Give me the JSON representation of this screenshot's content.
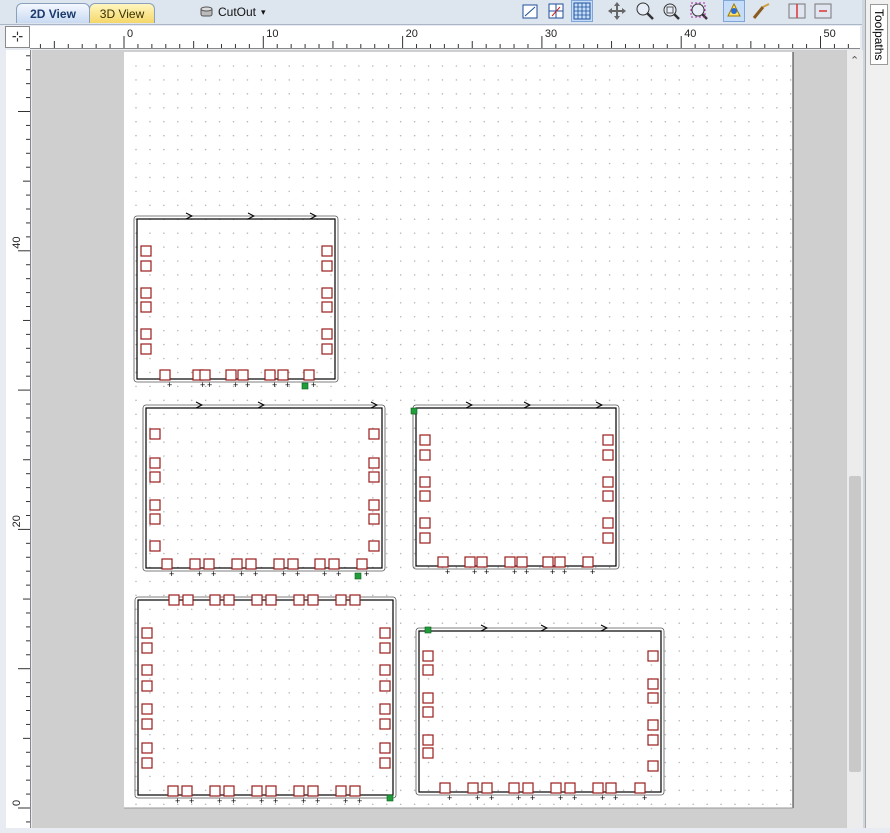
{
  "tabs": [
    {
      "label": "2D View",
      "active": true
    },
    {
      "label": "3D View",
      "active": false
    }
  ],
  "layer_dropdown": {
    "label": "CutOut",
    "arrow": "▾",
    "icon": "layer-stack-icon"
  },
  "toolbar_icons": [
    "set-job-size-icon",
    "edit-grid-icon",
    "snap-grid-icon",
    "pan-icon",
    "zoom-box-icon",
    "zoom-extents-icon",
    "zoom-selection-icon",
    "vector-select-icon",
    "node-edit-icon",
    "align-left-icon",
    "align-center-icon"
  ],
  "side_panel": {
    "label": "Toolpaths"
  },
  "ruler": {
    "horizontal_ticks": [
      "0",
      "10",
      "20",
      "30",
      "40",
      "50"
    ],
    "vertical_ticks": [
      "40",
      "20",
      "0"
    ]
  },
  "colors": {
    "tab_bar_bg": "#dde5ef",
    "canvas_bg": "#cfcfcf",
    "page_bg": "#ffffff",
    "tab_node": "#9b1b1b",
    "start_point": "#1f9e3a",
    "toolpath": "#000000"
  },
  "drawing": {
    "parts": 5,
    "description_shown": ""
  }
}
